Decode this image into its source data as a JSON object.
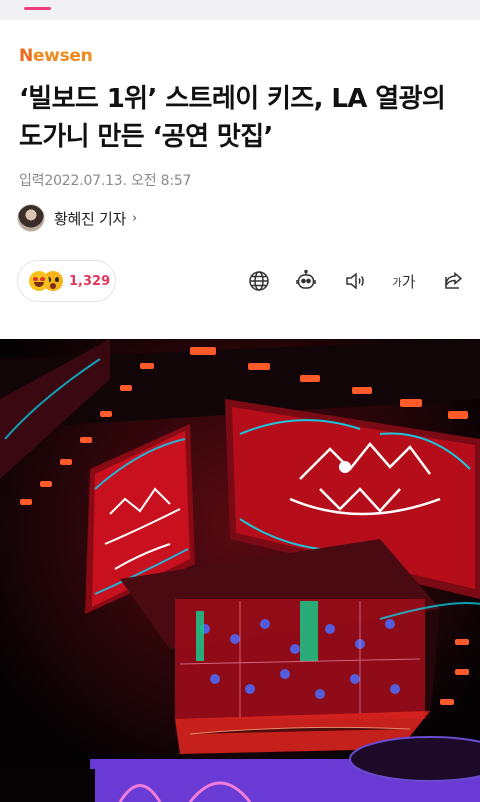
{
  "publisher": {
    "logo_first": "N",
    "logo_rest": "ewsen",
    "brand_color": "#ec6a1e"
  },
  "article": {
    "title": "‘빌보드 1위’ 스트레이 키즈, LA 열광의 도가니 만든 ‘공연 맛집’",
    "published": "입력2022.07.13. 오전 8:57",
    "reporter": "황혜진 기자",
    "reporter_chevron": "›"
  },
  "reactions": {
    "count": "1,329",
    "count_color": "#e0395b"
  },
  "toolbar": {
    "font_small": "가",
    "font_large": "가",
    "icons": [
      "globe-icon",
      "robot-icon",
      "speaker-icon",
      "font-size-icon",
      "share-icon"
    ]
  },
  "photo": {
    "subject": "stage-led-screens"
  }
}
